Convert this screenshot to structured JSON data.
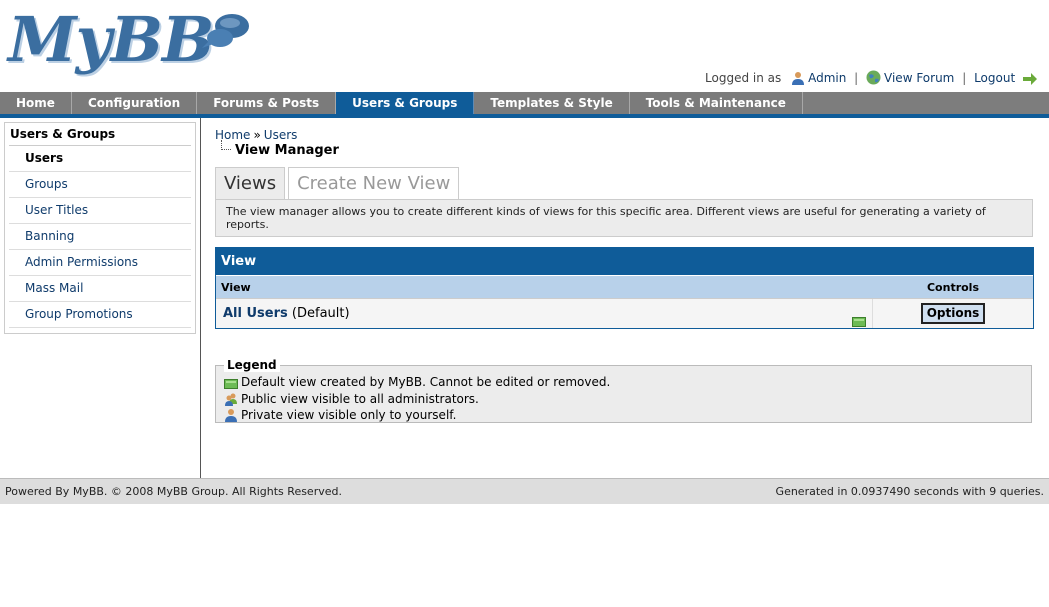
{
  "header": {
    "logo_text": "MyBB",
    "logged_in_as": "Logged in as",
    "user": "Admin",
    "view_forum": "View Forum",
    "logout": "Logout",
    "sep": "|"
  },
  "menu": {
    "items": [
      {
        "label": "Home"
      },
      {
        "label": "Configuration"
      },
      {
        "label": "Forums & Posts"
      },
      {
        "label": "Users & Groups"
      },
      {
        "label": "Templates & Style"
      },
      {
        "label": "Tools & Maintenance"
      }
    ],
    "active": "Users & Groups"
  },
  "sidebar": {
    "title": "Users & Groups",
    "items": [
      {
        "label": "Users"
      },
      {
        "label": "Groups"
      },
      {
        "label": "User Titles"
      },
      {
        "label": "Banning"
      },
      {
        "label": "Admin Permissions"
      },
      {
        "label": "Mass Mail"
      },
      {
        "label": "Group Promotions"
      }
    ]
  },
  "breadcrumb": {
    "home": "Home",
    "sep": "»",
    "users": "Users"
  },
  "page_title": "View Manager",
  "tabs": [
    {
      "label": "Views"
    },
    {
      "label": "Create New View"
    }
  ],
  "tab_description": "The view manager allows you to create different kinds of views for this specific area. Different views are useful for generating a variety of reports.",
  "view_table": {
    "title": "View",
    "columns": [
      "View",
      "Controls"
    ],
    "rows": [
      {
        "name": "All Users",
        "suffix": "(Default)",
        "control": "Options"
      }
    ]
  },
  "legend": {
    "title": "Legend",
    "items": [
      {
        "text": "Default view created by MyBB. Cannot be edited or removed.",
        "icon": "default-view-icon"
      },
      {
        "text": "Public view visible to all administrators.",
        "icon": "public-view-icon"
      },
      {
        "text": "Private view visible only to yourself.",
        "icon": "private-view-icon"
      }
    ]
  },
  "footer": {
    "left": "Powered By MyBB. © 2008 MyBB Group. All Rights Reserved.",
    "right": "Generated in 0.0937490 seconds with 9 queries."
  },
  "colors": {
    "accent": "#0f5c99",
    "menu_bg": "#7d7d7d",
    "link": "#0f3b6b"
  }
}
